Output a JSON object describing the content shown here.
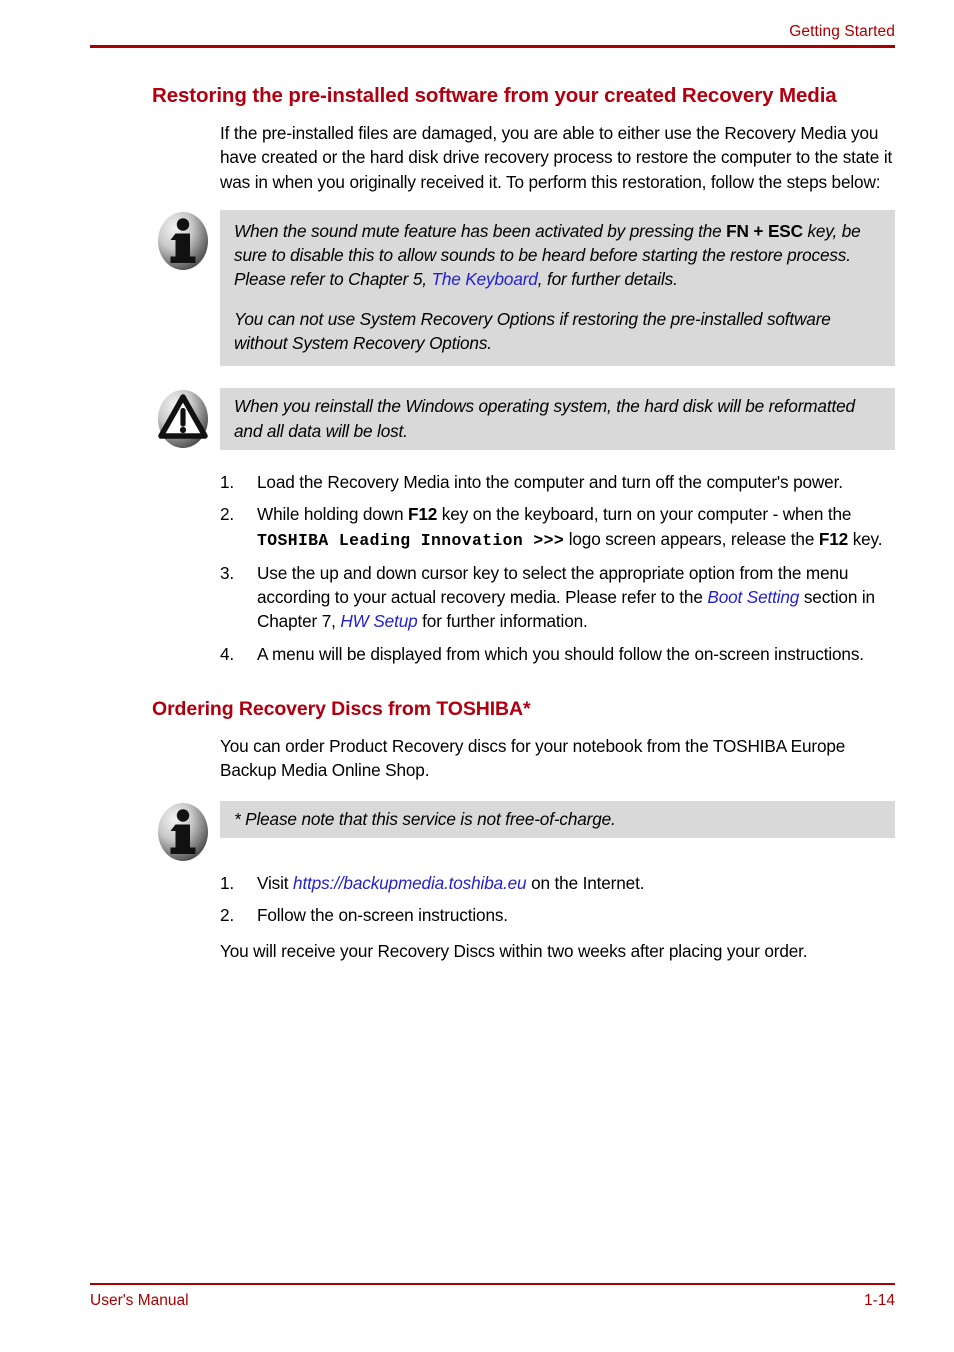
{
  "header": {
    "chapter_title": "Getting Started",
    "rule_color": "#a80000"
  },
  "colors": {
    "heading_red": "#b00010",
    "header_red": "#a80000",
    "note_background": "#d9d9d9",
    "link_blue": "#2222cc",
    "body_text": "#000000"
  },
  "sections": [
    {
      "title": "Restoring the pre-installed software from your created Recovery Media",
      "intro": "If the pre-installed files are damaged, you are able to either use the Recovery Media you have created or the hard disk drive recovery process to restore the computer to the state it was in when you originally received it. To perform this restoration, follow the steps below:",
      "note": {
        "icon": "info-icon",
        "paragraph1_a": "When the sound mute feature has been activated by pressing the ",
        "paragraph1_kbd1": "FN",
        "paragraph1_plus": " + ",
        "paragraph1_kbd2": "ESC",
        "paragraph1_b": " key, be sure to disable this to allow sounds to be heard before starting the restore process. Please refer to Chapter 5, ",
        "paragraph1_link": "The Keyboard",
        "paragraph1_c": ", for further details.",
        "paragraph2": "You can not use System Recovery Options if restoring the pre-installed software without System Recovery Options."
      },
      "caution": {
        "icon": "caution-icon",
        "text": "When you reinstall the Windows operating system, the hard disk will be reformatted and all data will be lost."
      },
      "steps": [
        {
          "num": "1.",
          "text": "Load the Recovery Media into the computer and turn off the computer's power."
        },
        {
          "num": "2.",
          "text_a": "While holding down ",
          "kbd1": "F12",
          "text_b": " key on the keyboard, turn on your computer - when the ",
          "logo": "TOSHIBA Leading Innovation >>>",
          "text_c": " logo screen appears, release the ",
          "kbd2": "F12",
          "text_d": " key."
        },
        {
          "num": "3.",
          "text_a": "Use the up and down cursor key to select the appropriate option from the menu according to your actual recovery media. Please refer to the ",
          "link1": "Boot Setting",
          "text_b": " section in Chapter 7, ",
          "link2": "HW Setup",
          "text_c": " for further information."
        },
        {
          "num": "4.",
          "text": "A menu will be displayed from which you should follow the on-screen instructions."
        }
      ]
    },
    {
      "title": "Ordering Recovery Discs from TOSHIBA*",
      "intro": "You can order Product Recovery discs for your notebook from the TOSHIBA Europe Backup Media Online Shop.",
      "note": {
        "icon": "info-icon",
        "text": "* Please note that this service is not free-of-charge."
      },
      "steps": [
        {
          "num": "1.",
          "text_a": "Visit ",
          "link": "https://backupmedia.toshiba.eu",
          "text_b": " on the Internet."
        },
        {
          "num": "2.",
          "text": "Follow the on-screen instructions."
        }
      ],
      "closing": "You will receive your Recovery Discs within two weeks after placing your order."
    }
  ],
  "footer": {
    "manual_label": "User's Manual",
    "page_number": "1-14"
  }
}
